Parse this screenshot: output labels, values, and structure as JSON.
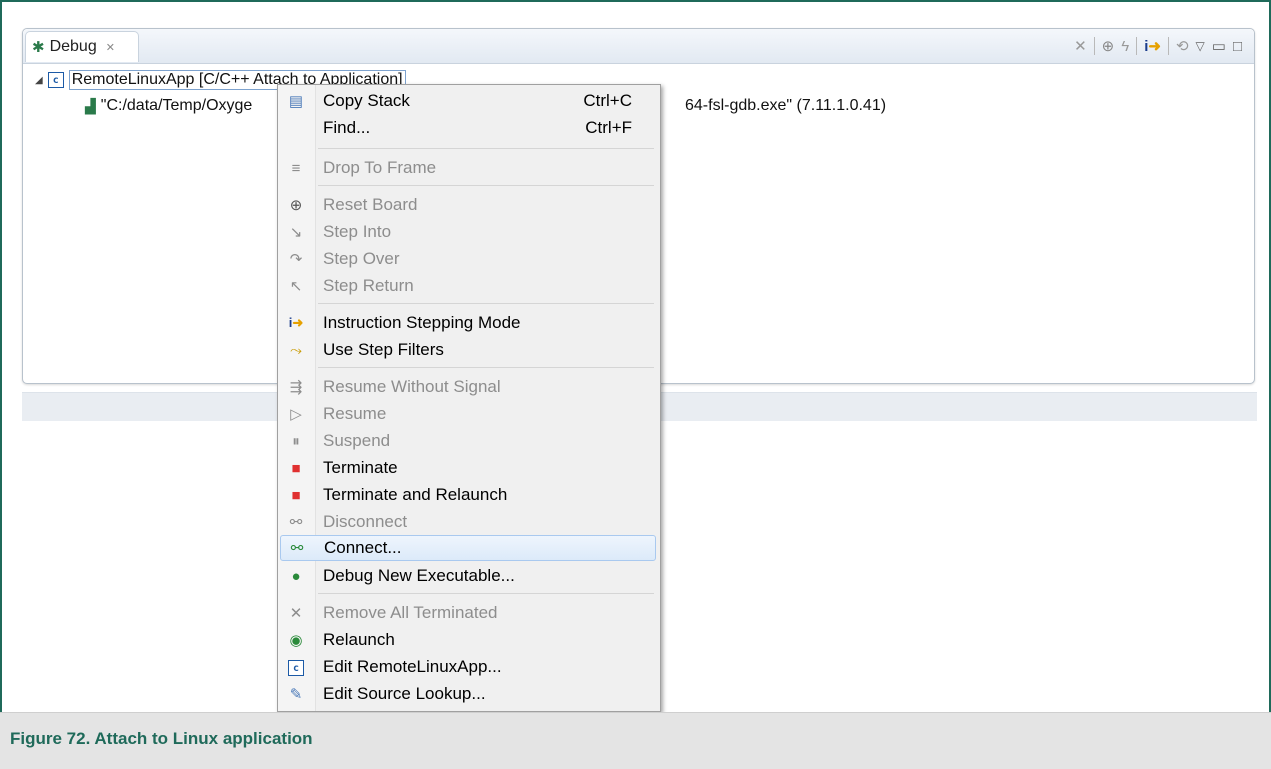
{
  "debug_view": {
    "tab_label": "Debug",
    "tree": {
      "app": "RemoteLinuxApp [C/C++ Attach to Application]",
      "gdb_left": "\"C:/data/Temp/Oxyge",
      "gdb_right": "64-fsl-gdb.exe\" (7.11.1.0.41)"
    }
  },
  "context_menu": {
    "items": [
      {
        "label": "Copy Stack",
        "shortcut": "Ctrl+C",
        "icon": "copy-icon",
        "enabled": true
      },
      {
        "label": "Find...",
        "shortcut": "Ctrl+F",
        "icon": "",
        "enabled": true
      },
      {
        "label": "Drop To Frame",
        "shortcut": "",
        "icon": "drop-to-frame-icon",
        "enabled": false
      },
      {
        "label": "Reset Board",
        "shortcut": "",
        "icon": "reset-board-icon",
        "enabled": false
      },
      {
        "label": "Step Into",
        "shortcut": "",
        "icon": "step-into-icon",
        "enabled": false
      },
      {
        "label": "Step Over",
        "shortcut": "",
        "icon": "step-over-icon",
        "enabled": false
      },
      {
        "label": "Step Return",
        "shortcut": "",
        "icon": "step-return-icon",
        "enabled": false
      },
      {
        "label": "Instruction Stepping Mode",
        "shortcut": "",
        "icon": "instruction-stepping-icon",
        "enabled": true
      },
      {
        "label": "Use Step Filters",
        "shortcut": "",
        "icon": "step-filters-icon",
        "enabled": true
      },
      {
        "label": "Resume Without Signal",
        "shortcut": "",
        "icon": "resume-without-signal-icon",
        "enabled": false
      },
      {
        "label": "Resume",
        "shortcut": "",
        "icon": "resume-icon",
        "enabled": false
      },
      {
        "label": "Suspend",
        "shortcut": "",
        "icon": "suspend-icon",
        "enabled": false
      },
      {
        "label": "Terminate",
        "shortcut": "",
        "icon": "terminate-icon",
        "enabled": true
      },
      {
        "label": "Terminate and Relaunch",
        "shortcut": "",
        "icon": "terminate-relaunch-icon",
        "enabled": true
      },
      {
        "label": "Disconnect",
        "shortcut": "",
        "icon": "disconnect-icon",
        "enabled": false
      },
      {
        "label": "Connect...",
        "shortcut": "",
        "icon": "connect-icon",
        "enabled": true,
        "highlighted": true
      },
      {
        "label": "Debug New Executable...",
        "shortcut": "",
        "icon": "debug-new-executable-icon",
        "enabled": true
      },
      {
        "label": "Remove All Terminated",
        "shortcut": "",
        "icon": "remove-terminated-icon",
        "enabled": false
      },
      {
        "label": "Relaunch",
        "shortcut": "",
        "icon": "relaunch-icon",
        "enabled": true
      },
      {
        "label": "Edit RemoteLinuxApp...",
        "shortcut": "",
        "icon": "edit-config-icon",
        "enabled": true
      },
      {
        "label": "Edit Source Lookup...",
        "shortcut": "",
        "icon": "edit-source-lookup-icon",
        "enabled": true
      }
    ]
  },
  "caption": "Figure 72. Attach to Linux application",
  "colors": {
    "frame": "#1f6a5a",
    "caption_text": "#1f6a5a",
    "caption_bg": "#e4e4e4",
    "menu_bg": "#f0f0f0",
    "highlight_border": "#a9c9ef",
    "disabled_text": "#8d8d8d"
  }
}
